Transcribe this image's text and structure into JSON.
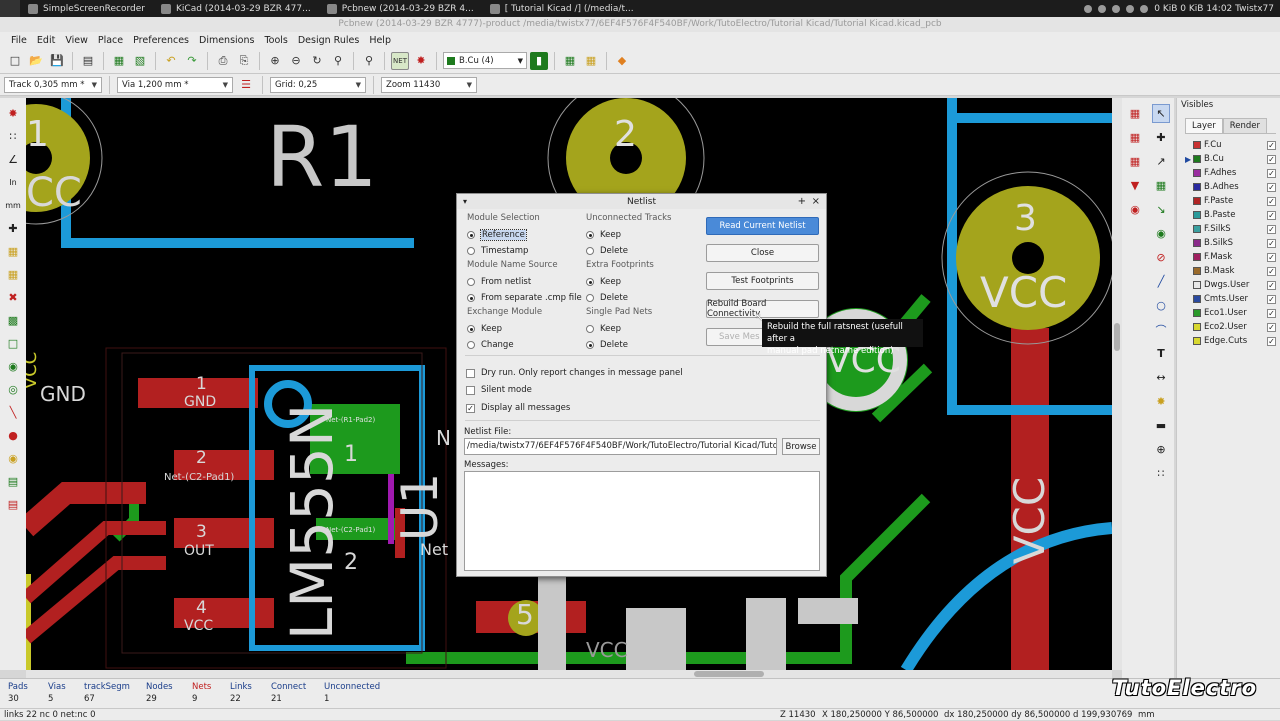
{
  "taskbar": {
    "tasks": [
      {
        "label": "SimpleScreenRecorder"
      },
      {
        "label": "KiCad (2014-03-29 BZR 477..."
      },
      {
        "label": "Pcbnew (2014-03-29 BZR 4..."
      },
      {
        "label": "[ Tutorial Kicad /] (/media/t..."
      }
    ],
    "status": "0 KiB 0 KiB 14:02 Twistx77"
  },
  "window": {
    "title": "Pcbnew (2014-03-29 BZR 4777)-product /media/twistx77/6EF4F576F4F540BF/Work/TutoElectro/Tutorial Kicad/Tutorial Kicad.kicad_pcb"
  },
  "menubar": {
    "items": [
      "File",
      "Edit",
      "View",
      "Place",
      "Preferences",
      "Dimensions",
      "Tools",
      "Design Rules",
      "Help"
    ]
  },
  "toolbar": {
    "layer": "B.Cu (4)"
  },
  "auxbar": {
    "track": "Track 0,305 mm *",
    "via": "Via 1,200 mm *",
    "grid": "Grid: 0,25",
    "zoom": "Zoom 11430"
  },
  "canvas": {
    "labels": {
      "r1": "R1",
      "pad1_top": "1",
      "pad2_top": "2",
      "cc": "CC",
      "vcc_left": "VCC",
      "gnd": "GND",
      "pin1": "1",
      "pin1_name": "GND",
      "pin2": "2",
      "pin2_net": "Net-(C2-Pad1)",
      "pin3": "3",
      "pin3_name": "OUT",
      "pin4": "4",
      "pin4_name": "VCC",
      "ic_name": "LM555N",
      "ic_ref": "U1",
      "c_net1": "Net-(R1-Pad2)",
      "c_net2": "Net-(C2-Pad1)",
      "c_pad1": "1",
      "c_pad2": "2",
      "n": "N",
      "net": "Net",
      "pad5": "5",
      "vcc_bottom": "VCC",
      "pad3_right": "3",
      "vcc_right": "VCC",
      "vcc_mid": "VCC",
      "vcc_vertical": "VCC"
    }
  },
  "visibles": {
    "title": "Visibles",
    "tabs": [
      "Layer",
      "Render"
    ],
    "layers": [
      {
        "name": "F.Cu",
        "color": "#c83232",
        "checked": true,
        "active": false
      },
      {
        "name": "B.Cu",
        "color": "#1d7a1d",
        "checked": true,
        "active": true
      },
      {
        "name": "F.Adhes",
        "color": "#9a2da0",
        "checked": true,
        "active": false
      },
      {
        "name": "B.Adhes",
        "color": "#2a2aa0",
        "checked": true,
        "active": false
      },
      {
        "name": "F.Paste",
        "color": "#b02424",
        "checked": true,
        "active": false
      },
      {
        "name": "B.Paste",
        "color": "#2a9a9a",
        "checked": true,
        "active": false
      },
      {
        "name": "F.SilkS",
        "color": "#3aa0a0",
        "checked": true,
        "active": false
      },
      {
        "name": "B.SilkS",
        "color": "#8a2a8a",
        "checked": true,
        "active": false
      },
      {
        "name": "F.Mask",
        "color": "#a02060",
        "checked": true,
        "active": false
      },
      {
        "name": "B.Mask",
        "color": "#9a6a2a",
        "checked": true,
        "active": false
      },
      {
        "name": "Dwgs.User",
        "color": "#e8e8e8",
        "checked": true,
        "active": false
      },
      {
        "name": "Cmts.User",
        "color": "#2a4aa0",
        "checked": true,
        "active": false
      },
      {
        "name": "Eco1.User",
        "color": "#2a9a2a",
        "checked": true,
        "active": false
      },
      {
        "name": "Eco2.User",
        "color": "#d8d830",
        "checked": true,
        "active": false
      },
      {
        "name": "Edge.Cuts",
        "color": "#d8d830",
        "checked": true,
        "active": false
      }
    ]
  },
  "status": {
    "columns": [
      {
        "label": "Pads",
        "value": "30",
        "red": false
      },
      {
        "label": "Vias",
        "value": "5",
        "red": false
      },
      {
        "label": "trackSegm",
        "value": "67",
        "red": false
      },
      {
        "label": "Nodes",
        "value": "29",
        "red": false
      },
      {
        "label": "Nets",
        "value": "9",
        "red": true
      },
      {
        "label": "Links",
        "value": "22",
        "red": false
      },
      {
        "label": "Connect",
        "value": "21",
        "red": false
      },
      {
        "label": "Unconnected",
        "value": "1",
        "red": false
      }
    ],
    "line": {
      "links": "links 22 nc 0  net:nc 0",
      "z": "Z 11430",
      "xy": "X 180,250000  Y 86,500000",
      "dxy": "dx 180,250000  dy 86,500000  d 199,930769",
      "units": "mm"
    },
    "watermark": "TutoElectro"
  },
  "dialog": {
    "title": "Netlist",
    "module_selection": {
      "title": "Module Selection",
      "options": [
        {
          "label": "Reference",
          "selected": true
        },
        {
          "label": "Timestamp",
          "selected": false
        }
      ]
    },
    "module_name_source": {
      "title": "Module Name Source",
      "options": [
        {
          "label": "From netlist",
          "selected": false
        },
        {
          "label": "From separate .cmp file",
          "selected": true
        }
      ]
    },
    "exchange_module": {
      "title": "Exchange Module",
      "options": [
        {
          "label": "Keep",
          "selected": true
        },
        {
          "label": "Change",
          "selected": false
        }
      ]
    },
    "unconnected_tracks": {
      "title": "Unconnected Tracks",
      "options": [
        {
          "label": "Keep",
          "selected": true
        },
        {
          "label": "Delete",
          "selected": false
        }
      ]
    },
    "extra_footprints": {
      "title": "Extra Footprints",
      "options": [
        {
          "label": "Keep",
          "selected": true
        },
        {
          "label": "Delete",
          "selected": false
        }
      ]
    },
    "single_pad_nets": {
      "title": "Single Pad Nets",
      "options": [
        {
          "label": "Keep",
          "selected": false
        },
        {
          "label": "Delete",
          "selected": true
        }
      ]
    },
    "buttons": {
      "read": "Read Current Netlist",
      "close": "Close",
      "test": "Test Footprints",
      "rebuild": "Rebuild Board Connectivity",
      "save": "Save Mes"
    },
    "checks": [
      {
        "label": "Dry run. Only report changes in message panel",
        "checked": false
      },
      {
        "label": "Silent mode",
        "checked": false
      },
      {
        "label": "Display all messages",
        "checked": true
      }
    ],
    "netlist_file_label": "Netlist File:",
    "netlist_file": "/media/twistx77/6EF4F576F4F540BF/Work/TutoElectro/Tutorial Kicad/Tutorial",
    "browse": "Browse",
    "messages_label": "Messages:"
  },
  "tooltip": {
    "line1": "Rebuild the full ratsnest (usefull after a",
    "line2": "manual pad netname edition)"
  }
}
